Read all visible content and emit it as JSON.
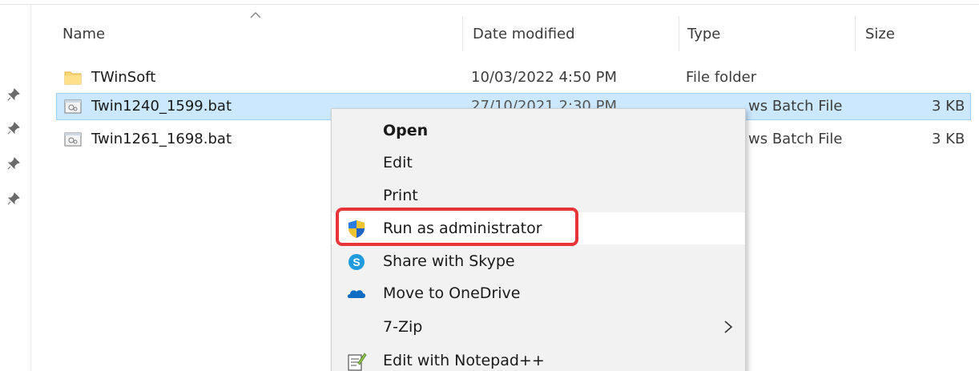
{
  "columns": {
    "name": "Name",
    "date_modified": "Date modified",
    "type": "Type",
    "size": "Size"
  },
  "files": [
    {
      "name": "TWinSoft",
      "date": "10/03/2022 4:50 PM",
      "type": "File folder",
      "size": "",
      "icon": "folder-icon"
    },
    {
      "name": "Twin1240_1599.bat",
      "date": "27/10/2021 2:30 PM",
      "type": "Windows Batch File",
      "size": "3 KB",
      "icon": "batch-file-icon"
    },
    {
      "name": "Twin1261_1698.bat",
      "date": "",
      "type": "Windows Batch File",
      "size": "3 KB",
      "icon": "batch-file-icon"
    }
  ],
  "visible_fragments": {
    "row2_type": "ws Batch File",
    "row3_type": "ws Batch File"
  },
  "context_menu": {
    "items": [
      {
        "label": "Open",
        "icon": ""
      },
      {
        "label": "Edit",
        "icon": ""
      },
      {
        "label": "Print",
        "icon": ""
      },
      {
        "label": "Run as administrator",
        "icon": "uac-shield-icon"
      },
      {
        "label": "Share with Skype",
        "icon": "skype-icon"
      },
      {
        "label": "Move to OneDrive",
        "icon": "onedrive-icon"
      },
      {
        "label": "7-Zip",
        "icon": "",
        "submenu": true
      },
      {
        "label": "Edit with Notepad++",
        "icon": "notepad-plus-plus-icon"
      }
    ]
  },
  "colors": {
    "selection": "#cce8ff",
    "selection_border": "#99d1ff",
    "highlight": "#e8353a",
    "menu_bg": "#f2f2f2"
  }
}
